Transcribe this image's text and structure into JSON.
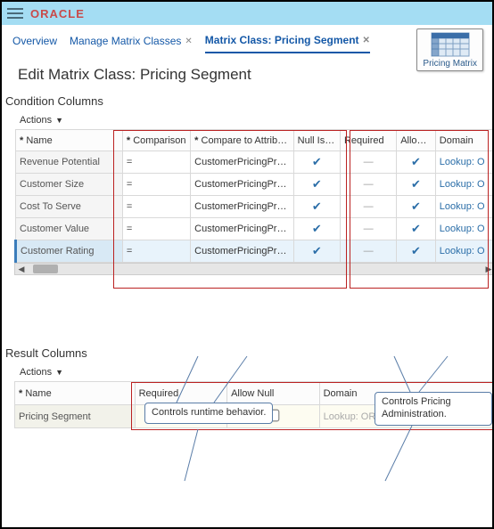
{
  "brand": "ORACLE",
  "tabs": {
    "overview": "Overview",
    "manage": "Manage Matrix Classes",
    "current": "Matrix Class: Pricing Segment"
  },
  "page_title": "Edit Matrix Class: Pricing Segment",
  "diagram_label": "Pricing Matrix",
  "section_condition": "Condition Columns",
  "section_result": "Result Columns",
  "actions_label": "Actions",
  "cols": {
    "name": "Name",
    "comparison": "Comparison",
    "compare_to": "Compare to Attribute",
    "null_wild": "Null Is Wildcard",
    "required": "Required",
    "allow_null": "Allow Null",
    "domain": "Domain"
  },
  "compare_symbol": "=",
  "compare_to_value": "CustomerPricingPr…",
  "domain_value": "Lookup: O",
  "rows": [
    {
      "name": "Revenue Potential",
      "selected": false
    },
    {
      "name": "Customer Size",
      "selected": false
    },
    {
      "name": "Cost To Serve",
      "selected": false
    },
    {
      "name": "Customer Value",
      "selected": false
    },
    {
      "name": "Customer Rating",
      "selected": true
    }
  ],
  "callouts": {
    "runtime": "Controls runtime behavior.",
    "admin": "Controls Pricing Administration."
  },
  "result": {
    "name": "Pricing Segment",
    "required": true,
    "allow_null": false,
    "domain": "Lookup: ORA_QP_CUST_PRICING_SE"
  }
}
